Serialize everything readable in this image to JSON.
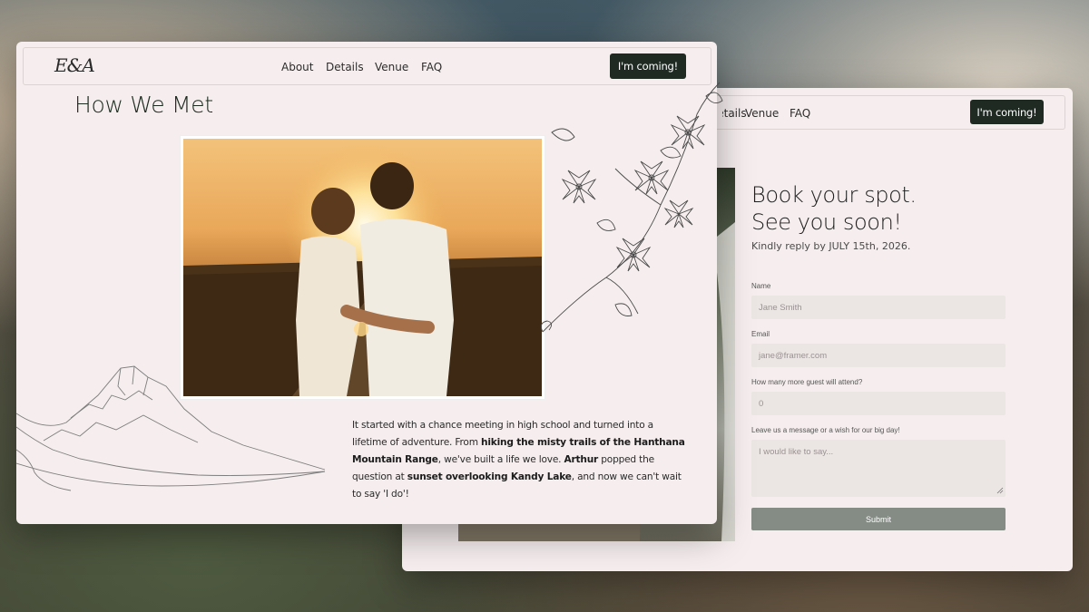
{
  "rsvp_page": {
    "nav": {
      "links": [
        "Details",
        "Venue",
        "FAQ"
      ],
      "cta_label": "I'm coming!"
    },
    "heading_line1": "Book your spot.",
    "heading_line2": "See you soon!",
    "subtext": "Kindly reply by JULY 15th, 2026.",
    "form": {
      "name_label": "Name",
      "name_placeholder": "Jane Smith",
      "email_label": "Email",
      "email_placeholder": "jane@framer.com",
      "guests_label": "How many more guest will attend?",
      "guests_placeholder": "0",
      "message_label": "Leave us a message or a wish for our big day!",
      "message_placeholder": "I would like to say...",
      "submit_label": "Submit"
    }
  },
  "story_page": {
    "logo": "E&A",
    "nav": {
      "links": [
        "About",
        "Details",
        "Venue",
        "FAQ"
      ],
      "cta_label": "I'm coming!"
    },
    "title": "How We  Met",
    "paragraph": {
      "p1": "It started with a chance meeting in high school and turned into a lifetime of adventure. From ",
      "b1": "hiking the misty trails of the Hanthana Mountain Range",
      "p2": ", we've built a life we love. ",
      "b2": "Arthur",
      "p3": " popped the question at ",
      "b3": "sunset overlooking Kandy Lake",
      "p4": ", and now we can't wait to say 'I do'!"
    }
  },
  "colors": {
    "card_bg": "#f6eeee",
    "cta_bg": "#1e2a22",
    "submit_bg": "#858c85",
    "input_bg": "#ebe5e4"
  },
  "icons": [
    "floral-illustration",
    "mountain-line-illustration"
  ]
}
